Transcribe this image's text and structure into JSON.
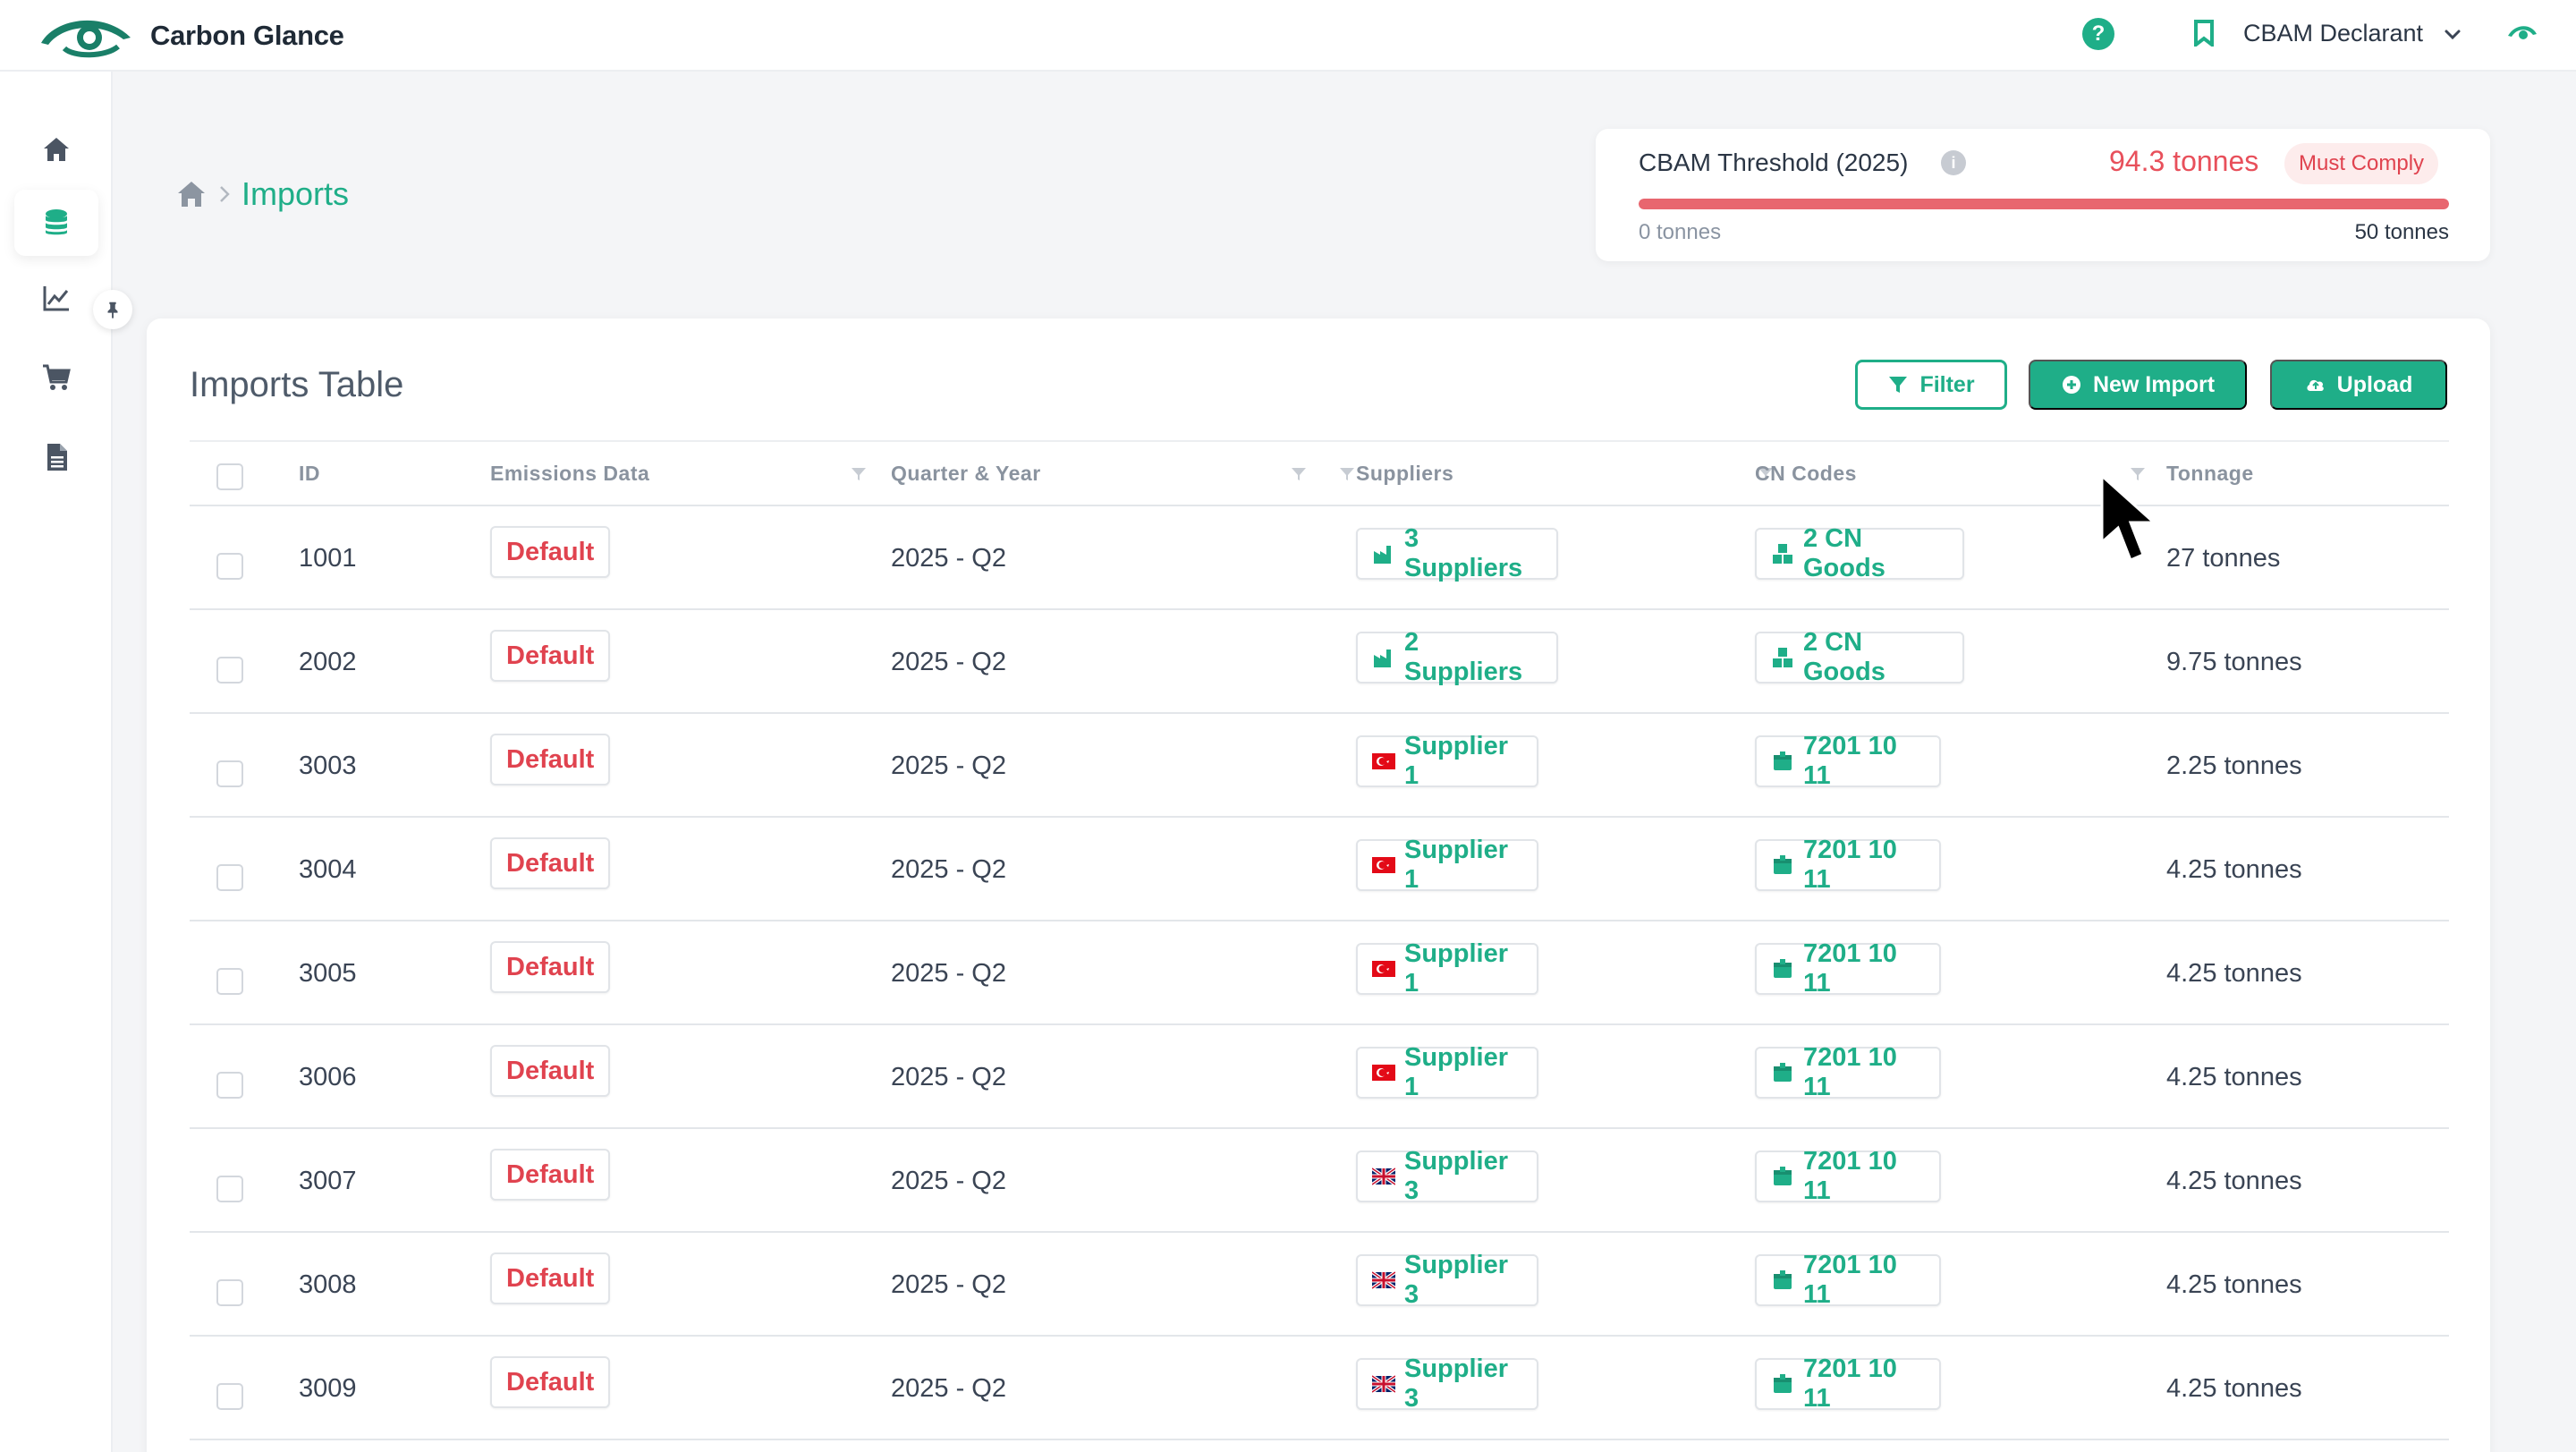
{
  "app": {
    "title": "Carbon Glance"
  },
  "header": {
    "help_icon": "question-icon",
    "org_icon": "bookmark-icon",
    "org_label": "CBAM Declarant"
  },
  "sidebar": {
    "items": [
      {
        "name": "home",
        "icon": "home-icon"
      },
      {
        "name": "imports",
        "icon": "database-icon",
        "active": true
      },
      {
        "name": "analytics",
        "icon": "chart-icon"
      },
      {
        "name": "goods",
        "icon": "cart-icon"
      },
      {
        "name": "reports",
        "icon": "document-icon"
      }
    ],
    "pin_icon": "pin-icon"
  },
  "breadcrumb": {
    "current": "Imports"
  },
  "threshold": {
    "title": "CBAM Threshold (2025)",
    "value": "94.3 tonnes",
    "status": "Must Comply",
    "min_label": "0 tonnes",
    "max_label": "50 tonnes",
    "progress_percent": 100,
    "colors": {
      "bar": "#e8666f",
      "value": "#e8505b"
    }
  },
  "table": {
    "title": "Imports Table",
    "buttons": {
      "filter": "Filter",
      "new_import": "New Import",
      "upload": "Upload"
    },
    "columns": [
      "ID",
      "Emissions Data",
      "Quarter & Year",
      "Suppliers",
      "CN Codes",
      "Tonnage"
    ],
    "rows": [
      {
        "id": "1001",
        "emissions": "Default",
        "quarter": "2025 - Q2",
        "supplier": "3 Suppliers",
        "supplier_icon": "factory-icon",
        "cn": "2 CN Goods",
        "cn_icon": "boxes-icon",
        "tonnage": "27 tonnes"
      },
      {
        "id": "2002",
        "emissions": "Default",
        "quarter": "2025 - Q2",
        "supplier": "2 Suppliers",
        "supplier_icon": "factory-icon",
        "cn": "2 CN Goods",
        "cn_icon": "boxes-icon",
        "tonnage": "9.75 tonnes"
      },
      {
        "id": "3003",
        "emissions": "Default",
        "quarter": "2025 - Q2",
        "supplier": "Supplier 1",
        "supplier_icon": "turkey-flag-icon",
        "cn": "7201 10 11",
        "cn_icon": "box-icon",
        "tonnage": "2.25 tonnes"
      },
      {
        "id": "3004",
        "emissions": "Default",
        "quarter": "2025 - Q2",
        "supplier": "Supplier 1",
        "supplier_icon": "turkey-flag-icon",
        "cn": "7201 10 11",
        "cn_icon": "box-icon",
        "tonnage": "4.25 tonnes"
      },
      {
        "id": "3005",
        "emissions": "Default",
        "quarter": "2025 - Q2",
        "supplier": "Supplier 1",
        "supplier_icon": "turkey-flag-icon",
        "cn": "7201 10 11",
        "cn_icon": "box-icon",
        "tonnage": "4.25 tonnes"
      },
      {
        "id": "3006",
        "emissions": "Default",
        "quarter": "2025 - Q2",
        "supplier": "Supplier 1",
        "supplier_icon": "turkey-flag-icon",
        "cn": "7201 10 11",
        "cn_icon": "box-icon",
        "tonnage": "4.25 tonnes"
      },
      {
        "id": "3007",
        "emissions": "Default",
        "quarter": "2025 - Q2",
        "supplier": "Supplier 3",
        "supplier_icon": "uk-flag-icon",
        "cn": "7201 10 11",
        "cn_icon": "box-icon",
        "tonnage": "4.25 tonnes"
      },
      {
        "id": "3008",
        "emissions": "Default",
        "quarter": "2025 - Q2",
        "supplier": "Supplier 3",
        "supplier_icon": "uk-flag-icon",
        "cn": "7201 10 11",
        "cn_icon": "box-icon",
        "tonnage": "4.25 tonnes"
      },
      {
        "id": "3009",
        "emissions": "Default",
        "quarter": "2025 - Q2",
        "supplier": "Supplier 3",
        "supplier_icon": "uk-flag-icon",
        "cn": "7201 10 11",
        "cn_icon": "box-icon",
        "tonnage": "4.25 tonnes"
      }
    ]
  },
  "theme": {
    "accent": "#1fae88",
    "danger": "#e0434f"
  }
}
